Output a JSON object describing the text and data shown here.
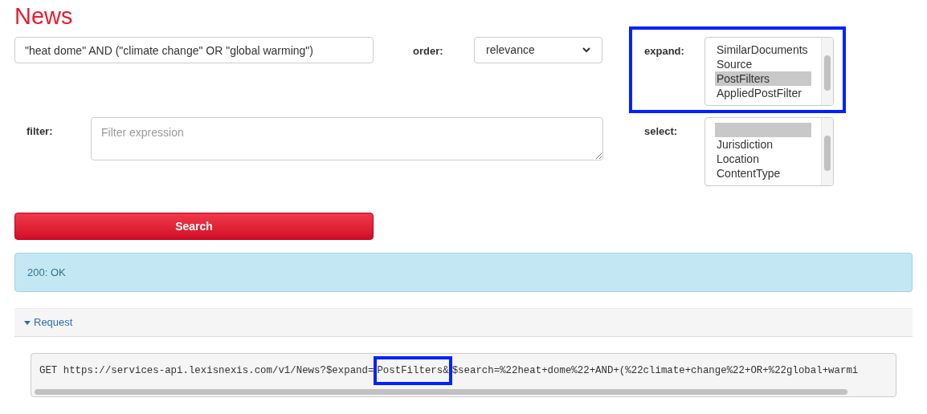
{
  "title": "News",
  "search": {
    "value": "\"heat dome\" AND (\"climate change\" OR \"global warming\")"
  },
  "order": {
    "label": "order:",
    "value": "relevance"
  },
  "expand": {
    "label": "expand:",
    "highlighted": true,
    "items": [
      {
        "label": "SimilarDocuments",
        "selected": false
      },
      {
        "label": "Source",
        "selected": false
      },
      {
        "label": "PostFilters",
        "selected": true
      },
      {
        "label": "AppliedPostFilter",
        "selected": false
      }
    ]
  },
  "filter": {
    "label": "filter:",
    "placeholder": "Filter expression"
  },
  "select": {
    "label": "select:",
    "items": [
      {
        "selected": true
      },
      {
        "label": "Jurisdiction",
        "selected": false
      },
      {
        "label": "Location",
        "selected": false
      },
      {
        "label": "ContentType",
        "selected": false
      }
    ]
  },
  "search_button": "Search",
  "status": "200: OK",
  "request": {
    "toggle": "Request",
    "expanded": true,
    "url_parts": [
      {
        "text": "GET https://services-api.lexisnexis.com/v1/News?$expand=",
        "highlighted": false
      },
      {
        "text": "PostFilters&",
        "highlighted": true
      },
      {
        "text": "$search=%22heat+dome%22+AND+(%22climate+change%22+OR+%22global+warmi",
        "highlighted": false
      }
    ]
  }
}
